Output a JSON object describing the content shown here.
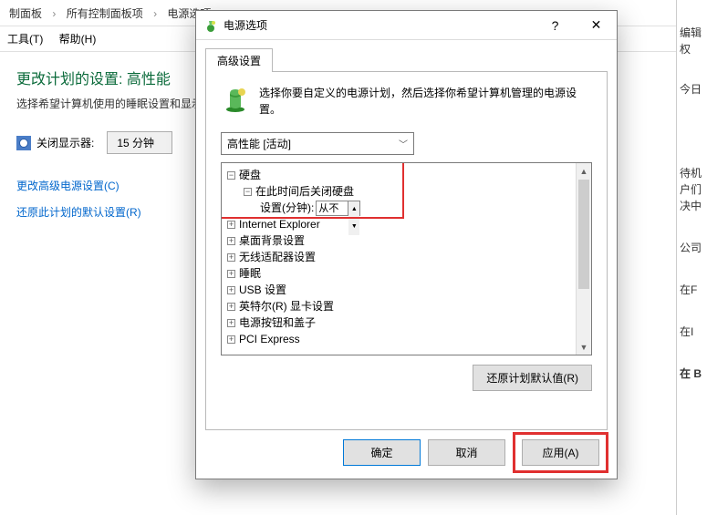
{
  "breadcrumb": {
    "items": [
      "制面板",
      "所有控制面板项",
      "电源选项"
    ],
    "current_truncated": "电源选项"
  },
  "menubar": {
    "tools": "工具(T)",
    "help": "帮助(H)"
  },
  "bg": {
    "page_title": "更改计划的设置: 高性能",
    "page_desc": "选择希望计算机使用的睡眠设置和显示",
    "display_off_label": "关闭显示器:",
    "display_off_value": "15 分钟",
    "link_advanced": "更改高级电源设置(C)",
    "link_restore": "还原此计划的默认设置(R)"
  },
  "right_panel": {
    "items": [
      "编辑",
      "权",
      "",
      "今日",
      "",
      "待机",
      "户们",
      "决中",
      "",
      "公司",
      "",
      "在F",
      "",
      "在I",
      "",
      "在 B"
    ]
  },
  "modal": {
    "title": "电源选项",
    "tab": "高级设置",
    "info_text": "选择你要自定义的电源计划，然后选择你希望计算机管理的电源设置。",
    "plan_selected": "高性能 [活动]",
    "tree": {
      "hard_disk": "硬盘",
      "turn_off_after": "在此时间后关闭硬盘",
      "setting_label": "设置(分钟):",
      "setting_value": "从不",
      "ie": "Internet Explorer",
      "desktop": "桌面背景设置",
      "wireless": "无线适配器设置",
      "sleep": "睡眠",
      "usb": "USB 设置",
      "intel": "英特尔(R) 显卡设置",
      "power_btn": "电源按钮和盖子",
      "pci": "PCI Express"
    },
    "restore_defaults": "还原计划默认值(R)",
    "ok": "确定",
    "cancel": "取消",
    "apply": "应用(A)"
  }
}
